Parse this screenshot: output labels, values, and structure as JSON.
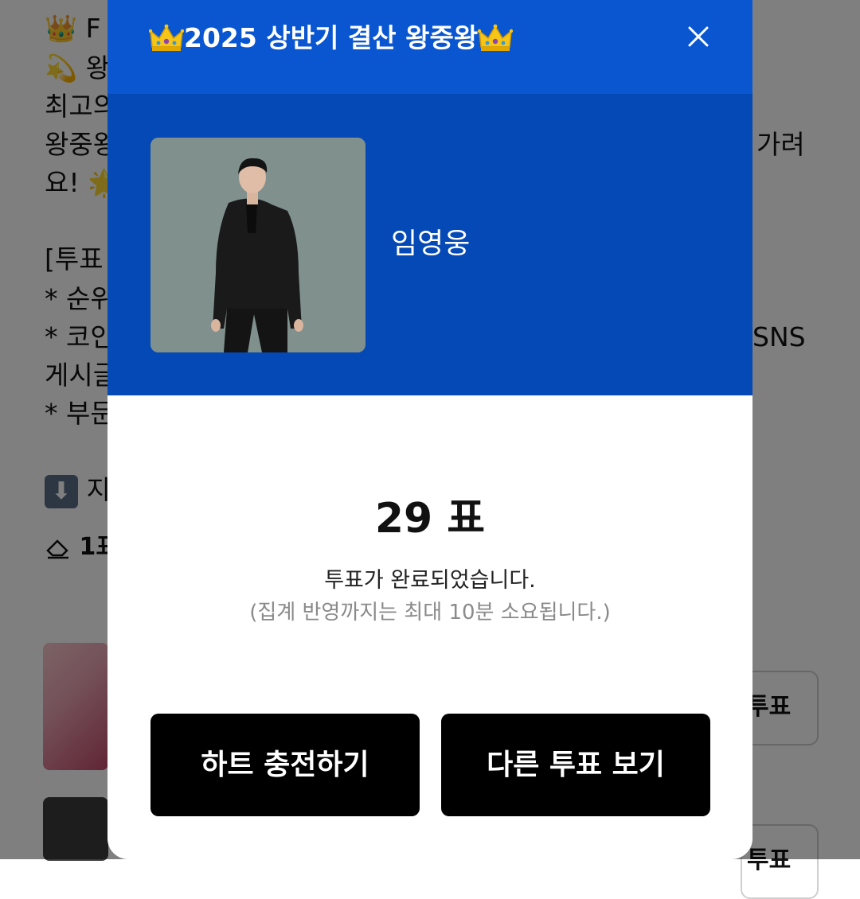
{
  "background": {
    "line1": "👑 F",
    "line2": "💫 왕",
    "line3": "최고의",
    "line4_left": "왕중왕",
    "line4_right": "가려",
    "line5": "요! 🌟",
    "line6": "[투표",
    "line7": "* 순위",
    "line8_left": "* 코인",
    "line8_right": "SNS",
    "line9": "게시글",
    "line10": "* 부문",
    "line11": "지",
    "line12": "1표",
    "vote_button_label": "투표"
  },
  "modal": {
    "title": "2025 상반기 결산 왕중왕",
    "candidate_name": "임영웅",
    "vote_count": "29 표",
    "complete_message": "투표가 완료되었습니다.",
    "sub_message": "(집계 반영까지는 최대 10분 소요됩니다.)",
    "charge_button": "하트 충전하기",
    "other_vote_button": "다른 투표 보기"
  },
  "colors": {
    "header_blue": "#0a56d1",
    "hero_blue": "#0449b5",
    "button_black": "#000000"
  },
  "icons": {
    "crown": "crown-icon",
    "close": "close-icon"
  }
}
